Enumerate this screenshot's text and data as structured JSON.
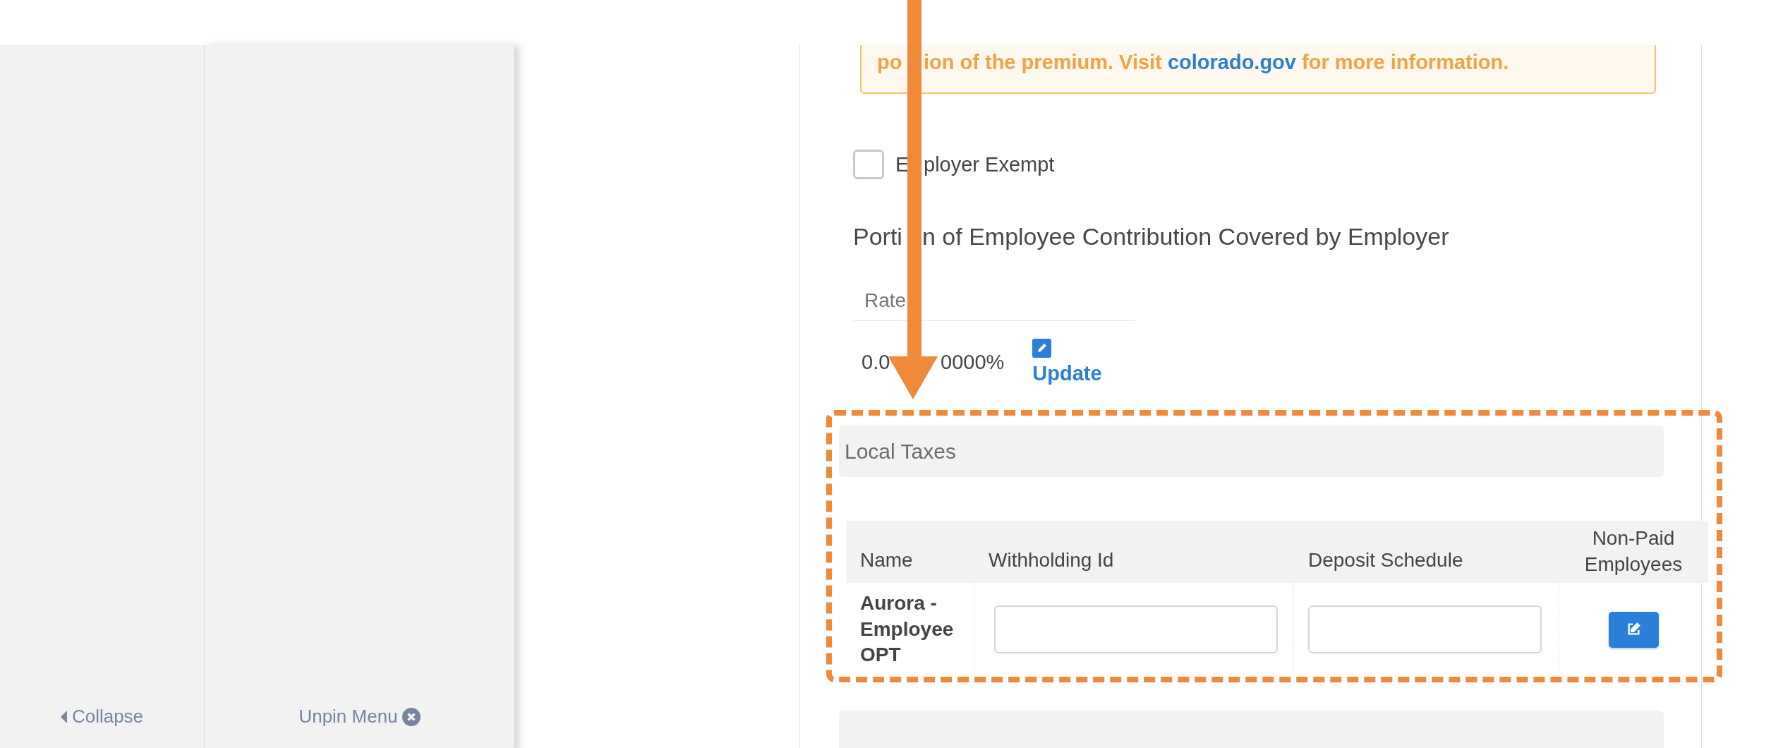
{
  "sidebar": {
    "collapse_label": "Collapse",
    "unpin_label": "Unpin Menu"
  },
  "notice": {
    "text_start": "po",
    "text_before": "ion of the premium. Visit ",
    "link": "colorado.gov",
    "text_after": " for more information."
  },
  "employer_exempt": {
    "label_start": "E",
    "label": "ployer Exempt",
    "checked": false
  },
  "contribution": {
    "heading_start": "Porti",
    "heading": "n of Employee Contribution Covered by Employer",
    "column": "Rate",
    "rate_start": "0.0",
    "rate": "0000%",
    "update_link": "Update"
  },
  "local_taxes": {
    "title": "Local Taxes",
    "columns": [
      "Name",
      "Withholding Id",
      "Deposit Schedule",
      "Non-Paid Employees"
    ],
    "rows": [
      {
        "name": "Aurora - Employee OPT"
      }
    ]
  },
  "annotations": {
    "arrow": true,
    "highlight_frame": true
  }
}
